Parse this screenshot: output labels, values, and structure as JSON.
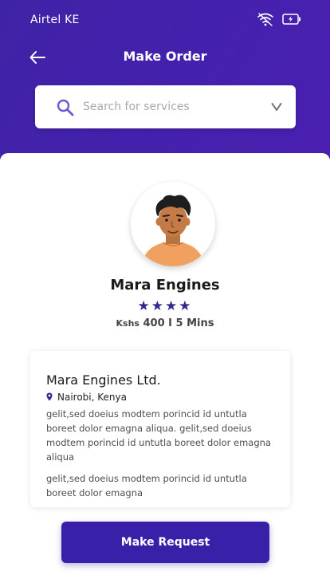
{
  "status_bar": {
    "carrier": "Airtel KE",
    "wifi_icon": "wifi-icon",
    "battery_icon": "battery-charging-icon"
  },
  "header": {
    "title": "Make Order",
    "back_icon": "arrow-left-icon"
  },
  "search": {
    "placeholder": "Search for services",
    "value": "",
    "search_icon": "search-icon",
    "dropdown_icon": "chevron-down-icon"
  },
  "provider": {
    "name": "Mara Engines",
    "rating": 4,
    "rating_max": 4,
    "currency": "Kshs",
    "price_eta": "400 I 5 Mins"
  },
  "details": {
    "company": "Mara Engines Ltd.",
    "location_icon": "location-pin-icon",
    "location": "Nairobi, Kenya",
    "paragraph_1": "gelit,sed doeius modtem porincid id untutla boreet dolor emagna aliqua. gelit,sed doeius modtem porincid id untutla boreet dolor emagna aliqua",
    "paragraph_2": "gelit,sed doeius modtem porincid id untutla boreet dolor emagna"
  },
  "actions": {
    "request_label": "Make Request"
  },
  "colors": {
    "primary": "#3a1fa8",
    "header_bg": "#4421ad",
    "star": "#2f2a8c"
  }
}
